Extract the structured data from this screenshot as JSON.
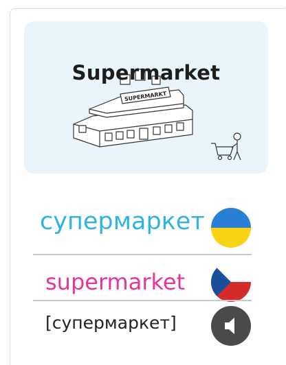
{
  "card": {
    "image_title": "Supermarket",
    "illustration_sign": "SUPERMARKT",
    "illustration_icon": "supermarket-illustration"
  },
  "words": {
    "ukrainian": "супермаркет",
    "czech": "supermarket",
    "transcription": "[супермаркет]"
  },
  "flags": {
    "ukraine": {
      "top": "#2a7fd4",
      "bottom": "#f7d313"
    },
    "czech": {
      "top": "#ffffff",
      "bottom": "#d42a2a",
      "triangle": "#1a4e9a"
    }
  },
  "colors": {
    "ukrainian_word": "#2fb3e6",
    "czech_word": "#e5359a",
    "panel_bg": "#e9f5fb",
    "audio_button": "#4a4a4a"
  },
  "audio": {
    "icon": "speaker-icon"
  }
}
